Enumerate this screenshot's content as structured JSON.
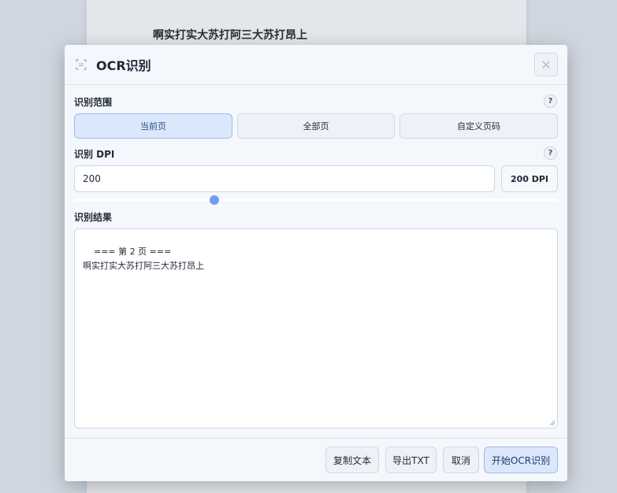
{
  "background": {
    "page_text": "啊实打实大苏打阿三大苏打昂上"
  },
  "dialog": {
    "title": "OCR识别",
    "close_label": "✕",
    "range": {
      "label": "识别范围",
      "help": "?",
      "options": [
        "当前页",
        "全部页",
        "自定义页码"
      ],
      "selected": "当前页"
    },
    "dpi": {
      "label": "识别 DPI",
      "help": "?",
      "value": "200",
      "badge": "200 DPI",
      "slider_fraction": 0.29
    },
    "result": {
      "label": "识别结果",
      "text": "=== 第 2 页 ===\n啊实打实大苏打阿三大苏打昂上"
    },
    "footer": {
      "copy": "复制文本",
      "export": "导出TXT",
      "cancel": "取消",
      "start": "开始OCR识别"
    }
  },
  "colors": {
    "accent": "#6f9ef0",
    "active_bg": "#dbe7fb",
    "active_border": "#9dbaf0"
  }
}
